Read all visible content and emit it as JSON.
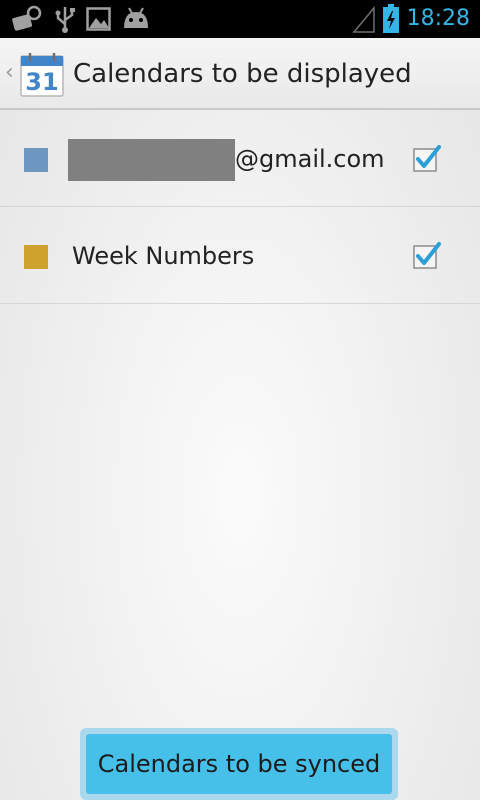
{
  "status_bar": {
    "time": "18:28",
    "icons": [
      "tools-icon",
      "usb-icon",
      "image-icon",
      "android-debug-icon",
      "signal-icon",
      "battery-charging-icon"
    ]
  },
  "action_bar": {
    "title": "Calendars to be displayed",
    "app_icon_label": "31",
    "up_caret": "‹"
  },
  "calendars": [
    {
      "label_suffix": "@gmail.com",
      "color": "#6d96c0",
      "checked": true,
      "redacted": true
    },
    {
      "label": "Week Numbers",
      "color": "#cfa22d",
      "checked": true
    }
  ],
  "sync_button": {
    "label": "Calendars to be synced"
  },
  "colors": {
    "accent": "#33b5e5",
    "check": "#2a9fd8",
    "button": "#46bfe9"
  }
}
